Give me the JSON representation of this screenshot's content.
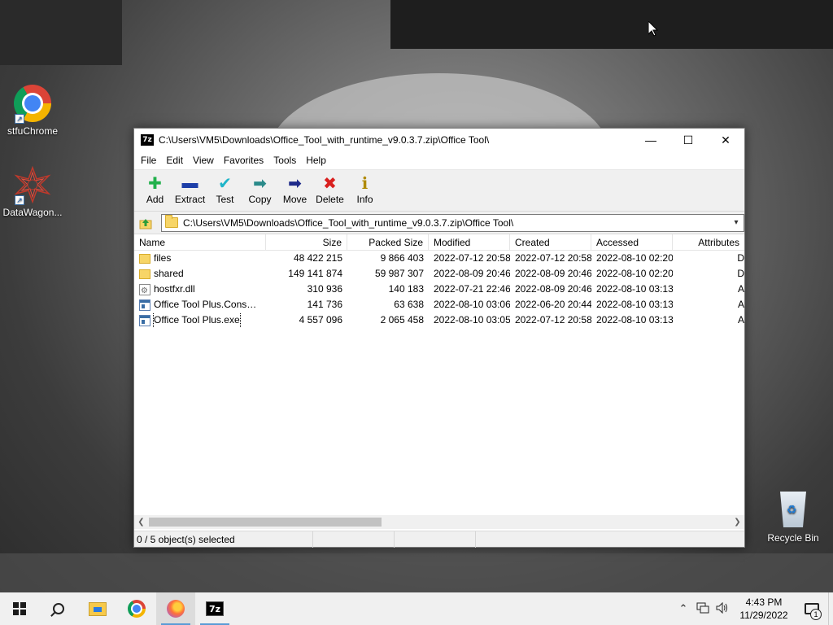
{
  "desktop": {
    "icons": [
      {
        "label": "stfuChrome",
        "icon": "chrome-icon"
      },
      {
        "label": "DataWagon...",
        "icon": "datawagon-icon"
      },
      {
        "label": "Recycle Bin",
        "icon": "recycle-bin-icon"
      }
    ]
  },
  "window": {
    "app_icon_label": "7z",
    "title": "C:\\Users\\VM5\\Downloads\\Office_Tool_with_runtime_v9.0.3.7.zip\\Office Tool\\",
    "controls": {
      "minimize": "—",
      "maximize": "☐",
      "close": "✕"
    }
  },
  "menu": [
    "File",
    "Edit",
    "View",
    "Favorites",
    "Tools",
    "Help"
  ],
  "toolbar": [
    {
      "label": "Add",
      "icon": "add-icon",
      "glyph": "✚",
      "color": "#22b14c"
    },
    {
      "label": "Extract",
      "icon": "extract-icon",
      "glyph": "▬",
      "color": "#1e3fa8"
    },
    {
      "label": "Test",
      "icon": "test-icon",
      "glyph": "✔",
      "color": "#1fb5c9"
    },
    {
      "label": "Copy",
      "icon": "copy-icon",
      "glyph": "➡",
      "color": "#2a8a8a"
    },
    {
      "label": "Move",
      "icon": "move-icon",
      "glyph": "➡",
      "color": "#1e2a8a"
    },
    {
      "label": "Delete",
      "icon": "delete-icon",
      "glyph": "✖",
      "color": "#d9201f"
    },
    {
      "label": "Info",
      "icon": "info-icon",
      "glyph": "ℹ",
      "color": "#b08a00"
    }
  ],
  "address": {
    "path": "C:\\Users\\VM5\\Downloads\\Office_Tool_with_runtime_v9.0.3.7.zip\\Office Tool\\"
  },
  "columns": [
    "Name",
    "Size",
    "Packed Size",
    "Modified",
    "Created",
    "Accessed",
    "Attributes"
  ],
  "files": [
    {
      "name": "files",
      "type": "folder",
      "size": "48 422 215",
      "packed": "9 866 403",
      "modified": "2022-07-12 20:58",
      "created": "2022-07-12 20:58",
      "accessed": "2022-08-10 02:20",
      "attr": "D"
    },
    {
      "name": "shared",
      "type": "folder",
      "size": "149 141 874",
      "packed": "59 987 307",
      "modified": "2022-08-09 20:46",
      "created": "2022-08-09 20:46",
      "accessed": "2022-08-10 02:20",
      "attr": "D"
    },
    {
      "name": "hostfxr.dll",
      "type": "dll",
      "size": "310 936",
      "packed": "140 183",
      "modified": "2022-07-21 22:46",
      "created": "2022-08-09 20:46",
      "accessed": "2022-08-10 03:13",
      "attr": "A"
    },
    {
      "name": "Office Tool Plus.Consol...",
      "type": "exe",
      "size": "141 736",
      "packed": "63 638",
      "modified": "2022-08-10 03:06",
      "created": "2022-06-20 20:44",
      "accessed": "2022-08-10 03:13",
      "attr": "A"
    },
    {
      "name": "Office Tool Plus.exe",
      "type": "exe",
      "size": "4 557 096",
      "packed": "2 065 458",
      "modified": "2022-08-10 03:05",
      "created": "2022-07-12 20:58",
      "accessed": "2022-08-10 03:13",
      "attr": "A"
    }
  ],
  "status": {
    "selection": "0 / 5 object(s) selected"
  },
  "taskbar": {
    "clock_time": "4:43 PM",
    "clock_date": "11/29/2022",
    "notification_count": "1"
  }
}
